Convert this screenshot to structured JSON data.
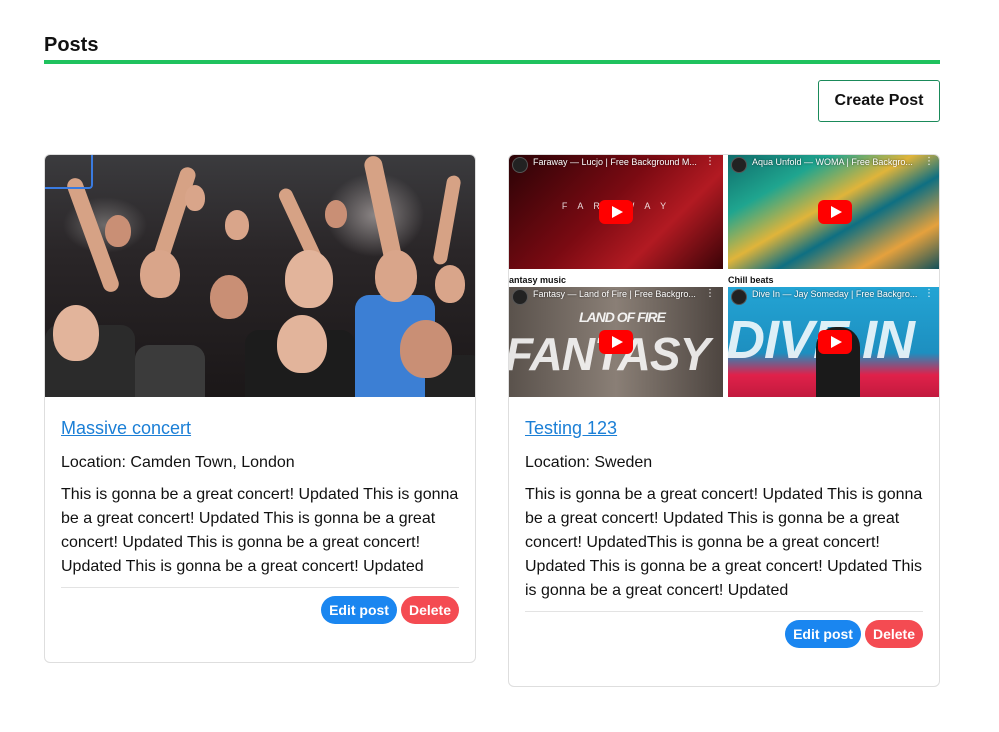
{
  "header": {
    "title": "Posts",
    "accent_color": "#1fc25e"
  },
  "actions": {
    "create_label": "Create Post"
  },
  "posts": [
    {
      "title": "Massive concert",
      "location": "Location: Camden Town, London",
      "body": "This is gonna be a great concert! Updated This is gonna be a great concert! Updated This is gonna be a great concert! Updated This is gonna be a great concert! Updated This is gonna be a great concert! Updated",
      "media_type": "photo",
      "edit_label": "Edit post",
      "delete_label": "Delete"
    },
    {
      "title": "Testing 123",
      "location": "Location: Sweden",
      "body": "This is gonna be a great concert! Updated This is gonna be a great concert! Updated This is gonna be a great concert! UpdatedThis is gonna be a great concert! Updated This is gonna be a great concert! Updated This is gonna be a great concert! Updated",
      "media_type": "video-grid",
      "videos": [
        {
          "title": "Faraway — Lucjo | Free Background M...",
          "overlay": "F A R A W A Y"
        },
        {
          "title": "Aqua Unfold — WOMA | Free Backgro...",
          "overlay": ""
        },
        {
          "title": "Fantasy — Land of Fire | Free Backgro...",
          "overlay": "FANTASY",
          "subtitle": "LAND OF FIRE"
        },
        {
          "title": "Dive In — Jay Someday | Free Backgro...",
          "overlay": "DIVE IN"
        }
      ],
      "captions": [
        "antasy music",
        "Chill beats"
      ],
      "edit_label": "Edit post",
      "delete_label": "Delete"
    }
  ],
  "colors": {
    "link": "#1b7fd6",
    "edit": "#1a86f0",
    "delete": "#f44b52"
  }
}
